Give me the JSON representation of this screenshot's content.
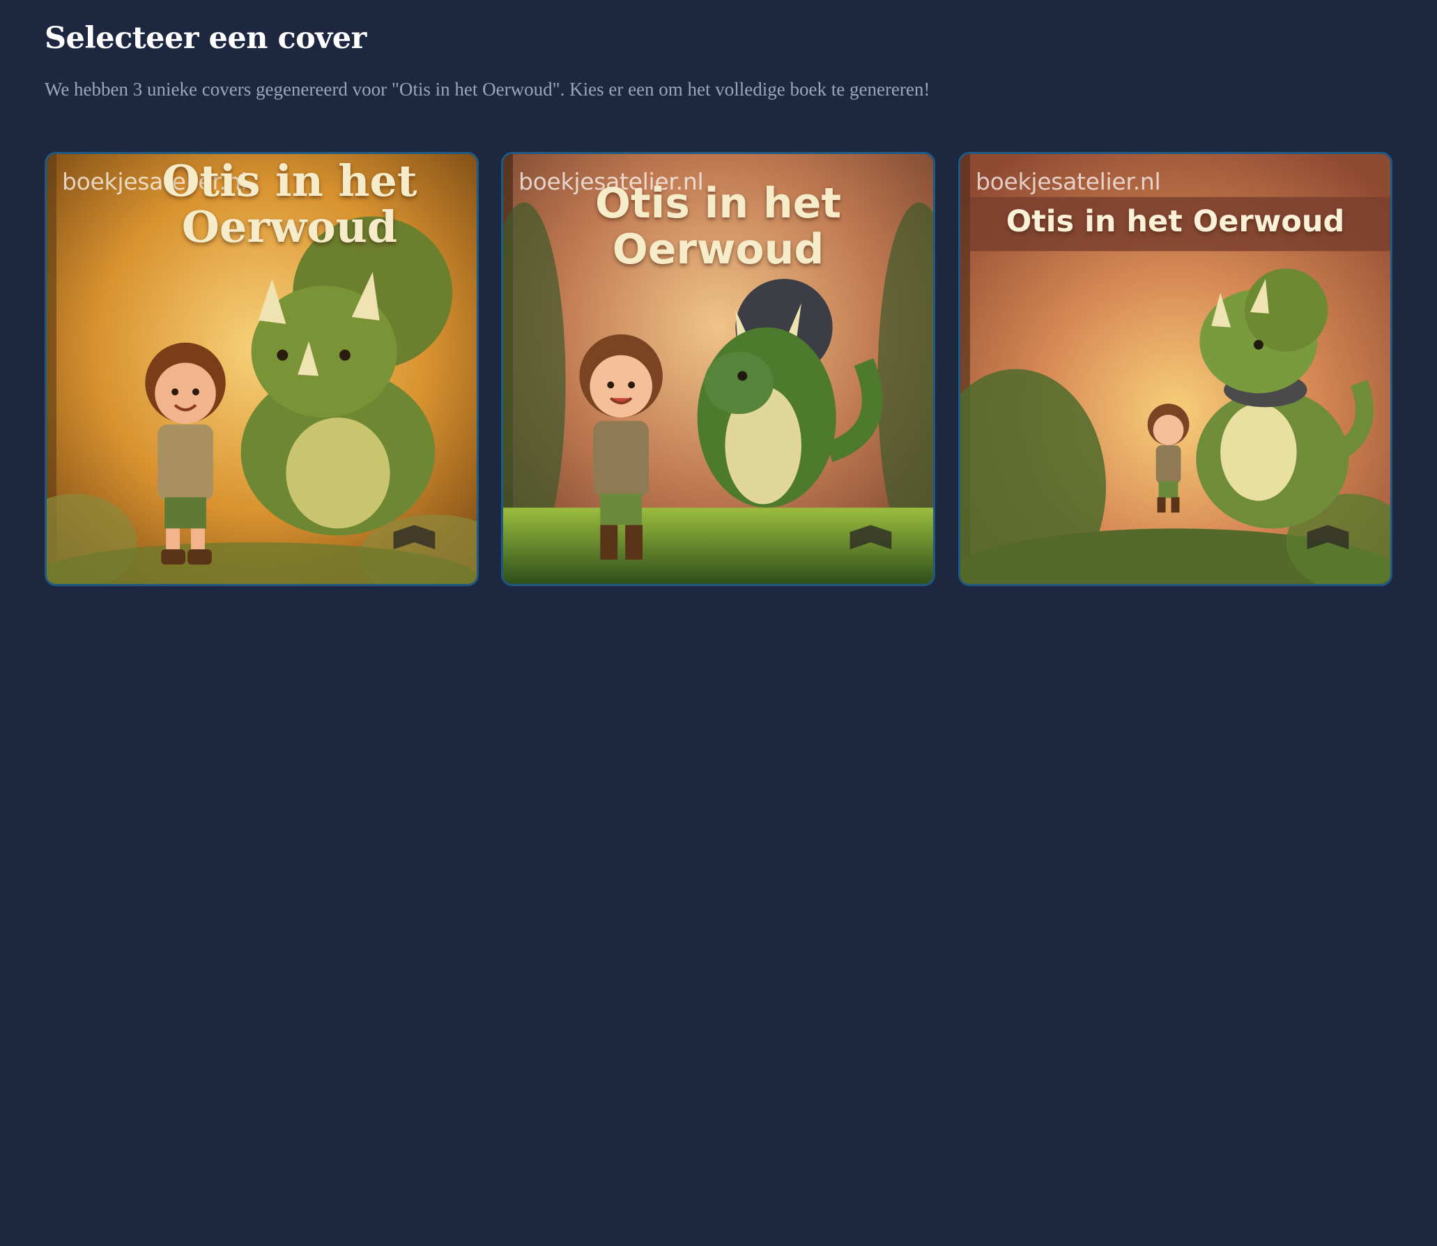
{
  "header": {
    "title": "Selecteer een cover",
    "subtitle": "We hebben 3 unieke covers gegenereerd voor \"Otis in het Oerwoud\". Kies er een om het volledige boek te genereren!"
  },
  "covers": [
    {
      "watermark": "boekjesatelier.nl",
      "title_line1": "Otis in het",
      "title_line2": "Oerwoud"
    },
    {
      "watermark": "boekjesatelier.nl",
      "title_line1": "Otis in het",
      "title_line2": "Oerwoud"
    },
    {
      "watermark": "boekjesatelier.nl",
      "title_line1": "Otis in het Oerwoud",
      "title_line2": ""
    }
  ],
  "colors": {
    "background": "#1d2840",
    "card_border": "#1f5a84",
    "subtitle": "#9aa6ba"
  }
}
